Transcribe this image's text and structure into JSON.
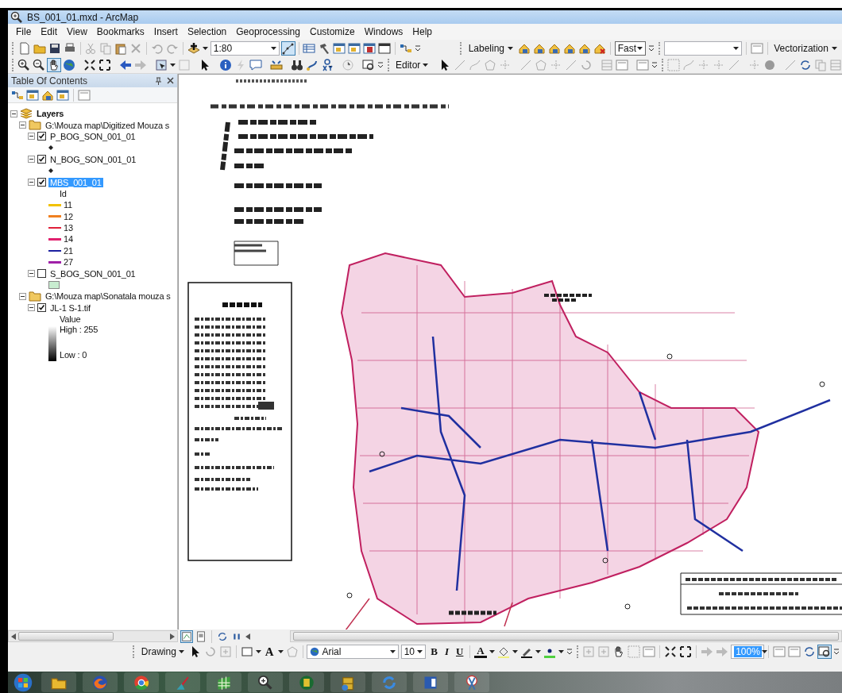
{
  "window": {
    "title": "BS_001_01.mxd - ArcMap"
  },
  "menu": [
    "File",
    "Edit",
    "View",
    "Bookmarks",
    "Insert",
    "Selection",
    "Geoprocessing",
    "Customize",
    "Windows",
    "Help"
  ],
  "standard_toolbar": {
    "scale": "1:80"
  },
  "labeling_toolbar": {
    "label": "Labeling",
    "quality": "Fast"
  },
  "vectorization_toolbar": {
    "label": "Vectorization"
  },
  "editor_toolbar": {
    "label": "Editor"
  },
  "table_of_contents": {
    "title": "Table Of Contents",
    "tree": [
      {
        "kind": "root",
        "label": "Layers",
        "expanded": true,
        "selected": false,
        "children": [
          {
            "kind": "group",
            "label": "G:\\Mouza map\\Digitized Mouza s",
            "expanded": true,
            "selected": false,
            "children": [
              {
                "kind": "layer",
                "label": "P_BOG_SON_001_01",
                "expanded": true,
                "checked": true,
                "selected": false,
                "legend": [
                  {
                    "kind": "point"
                  }
                ]
              },
              {
                "kind": "layer",
                "label": "N_BOG_SON_001_01",
                "expanded": true,
                "checked": true,
                "selected": false,
                "legend": [
                  {
                    "kind": "point"
                  }
                ]
              },
              {
                "kind": "layer",
                "label": "MBS_001_01",
                "expanded": true,
                "checked": true,
                "selected": true,
                "legend": [
                  {
                    "kind": "heading",
                    "label": "Id"
                  },
                  {
                    "kind": "line",
                    "label": "11",
                    "color": "#f2c200"
                  },
                  {
                    "kind": "line",
                    "label": "12",
                    "color": "#f08020"
                  },
                  {
                    "kind": "line",
                    "label": "13",
                    "color": "#e0203a"
                  },
                  {
                    "kind": "line",
                    "label": "14",
                    "color": "#e0206e"
                  },
                  {
                    "kind": "line",
                    "label": "21",
                    "color": "#1c20a0"
                  },
                  {
                    "kind": "line",
                    "label": "27",
                    "color": "#a020a8"
                  }
                ]
              },
              {
                "kind": "layer",
                "label": "S_BOG_SON_001_01",
                "expanded": true,
                "checked": false,
                "selected": false,
                "legend": [
                  {
                    "kind": "fill",
                    "color": "#c8ecd0"
                  }
                ]
              }
            ]
          },
          {
            "kind": "group",
            "label": "G:\\Mouza map\\Sonatala mouza s",
            "expanded": true,
            "selected": false,
            "children": [
              {
                "kind": "layer",
                "label": "JL-1 S-1.tif",
                "expanded": true,
                "checked": true,
                "selected": false,
                "legend": [
                  {
                    "kind": "raster",
                    "label": "Value",
                    "high": "High : 255",
                    "low": "Low : 0"
                  }
                ]
              }
            ]
          }
        ]
      }
    ]
  },
  "drawing_toolbar": {
    "label": "Drawing",
    "text_tool": "A",
    "font": "Arial",
    "size": "10",
    "bold": "B",
    "italic": "I",
    "underline": "U",
    "font_color": "A"
  },
  "layout_toolbar": {
    "zoom": "100%"
  }
}
